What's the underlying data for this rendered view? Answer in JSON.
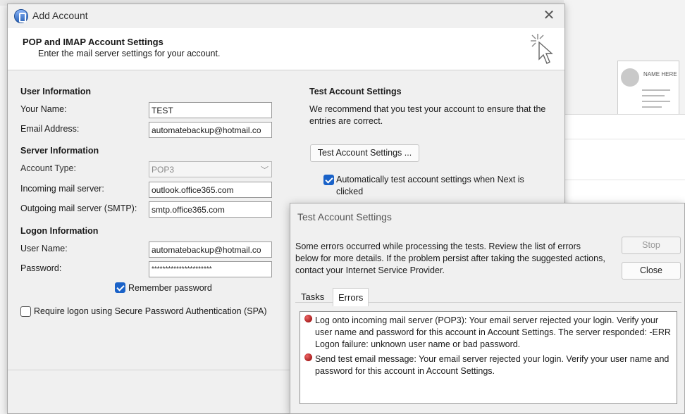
{
  "dialog": {
    "title": "Add Account",
    "header_title": "POP and IMAP Account Settings",
    "header_subtitle": "Enter the mail server settings for your account."
  },
  "user_info": {
    "section": "User Information",
    "name_label": "Your Name:",
    "name_value": "TEST",
    "email_label": "Email Address:",
    "email_value": "automatebackup@hotmail.co"
  },
  "server_info": {
    "section": "Server Information",
    "account_type_label": "Account Type:",
    "account_type_value": "POP3",
    "incoming_label": "Incoming mail server:",
    "incoming_value": "outlook.office365.com",
    "outgoing_label": "Outgoing mail server (SMTP):",
    "outgoing_value": "smtp.office365.com"
  },
  "logon_info": {
    "section": "Logon Information",
    "username_label": "User Name:",
    "username_value": "automatebackup@hotmail.co",
    "password_label": "Password:",
    "password_value": "**********************",
    "remember_label": "Remember password",
    "spa_label": "Require logon using Secure Password Authentication (SPA)"
  },
  "test_settings": {
    "section": "Test Account Settings",
    "description": "We recommend that you test your account to ensure that the entries are correct.",
    "button_label": "Test Account Settings ...",
    "auto_test_label": "Automatically test account settings when Next is clicked"
  },
  "test_dialog": {
    "title": "Test Account Settings",
    "message": "Some errors occurred while processing the tests. Review the list of errors below for more details. If the problem persist after taking the suggested actions, contact your Internet Service Provider.",
    "stop_label": "Stop",
    "close_label": "Close",
    "tabs": [
      "Tasks",
      "Errors"
    ],
    "errors": [
      "Log onto incoming mail server (POP3): Your email server rejected your login. Verify your user name and password for this account in Account Settings.  The server responded: -ERR Logon failure: unknown user name or bad password.",
      "Send test email message: Your email server rejected your login. Verify your user name and password for this account in Account Settings."
    ]
  },
  "background": {
    "card_text": "NAME HERE"
  }
}
